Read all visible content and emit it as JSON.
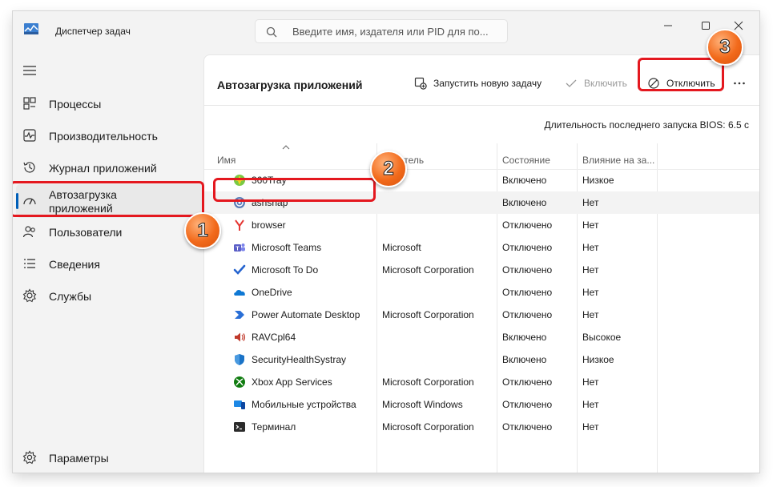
{
  "titlebar": {
    "title": "Диспетчер задач",
    "search_placeholder": "Введите имя, издателя или PID для по..."
  },
  "sidebar": {
    "items": [
      {
        "label": "Процессы",
        "icon": "processes-icon"
      },
      {
        "label": "Производительность",
        "icon": "performance-icon"
      },
      {
        "label": "Журнал приложений",
        "icon": "app-history-icon"
      },
      {
        "label": "Автозагрузка приложений",
        "icon": "startup-apps-icon",
        "active": true
      },
      {
        "label": "Пользователи",
        "icon": "users-icon"
      },
      {
        "label": "Сведения",
        "icon": "details-icon"
      },
      {
        "label": "Службы",
        "icon": "services-icon"
      }
    ],
    "settings_label": "Параметры"
  },
  "main": {
    "title": "Автозагрузка приложений",
    "toolbar": {
      "run_task": "Запустить новую задачу",
      "enable": "Включить",
      "disable": "Отключить"
    },
    "bios_text": "Длительность последнего запуска BIOS: 6.5 с",
    "columns": [
      "Имя",
      "Издатель",
      "Состояние",
      "Влияние на за..."
    ],
    "rows": [
      {
        "name": "360Tray",
        "publisher": "",
        "status": "Включено",
        "impact": "Низкое",
        "icon": "360tray-icon"
      },
      {
        "name": "ashsnap",
        "publisher": "",
        "status": "Включено",
        "impact": "Нет",
        "icon": "ashsnap-icon",
        "selected": true
      },
      {
        "name": "browser",
        "publisher": "",
        "status": "Отключено",
        "impact": "Нет",
        "icon": "yandex-browser-icon"
      },
      {
        "name": "Microsoft Teams",
        "publisher": "Microsoft",
        "status": "Отключено",
        "impact": "Нет",
        "icon": "teams-icon"
      },
      {
        "name": "Microsoft To Do",
        "publisher": "Microsoft Corporation",
        "status": "Отключено",
        "impact": "Нет",
        "icon": "todo-icon"
      },
      {
        "name": "OneDrive",
        "publisher": "",
        "status": "Отключено",
        "impact": "Нет",
        "icon": "onedrive-icon"
      },
      {
        "name": "Power Automate Desktop",
        "publisher": "Microsoft Corporation",
        "status": "Отключено",
        "impact": "Нет",
        "icon": "power-automate-icon"
      },
      {
        "name": "RAVCpl64",
        "publisher": "",
        "status": "Включено",
        "impact": "Высокое",
        "icon": "speaker-icon"
      },
      {
        "name": "SecurityHealthSystray",
        "publisher": "",
        "status": "Включено",
        "impact": "Низкое",
        "icon": "security-shield-icon"
      },
      {
        "name": "Xbox App Services",
        "publisher": "Microsoft Corporation",
        "status": "Отключено",
        "impact": "Нет",
        "icon": "xbox-icon"
      },
      {
        "name": "Мобильные устройства",
        "publisher": "Microsoft Windows",
        "status": "Отключено",
        "impact": "Нет",
        "icon": "phone-link-icon"
      },
      {
        "name": "Терминал",
        "publisher": "Microsoft Corporation",
        "status": "Отключено",
        "impact": "Нет",
        "icon": "terminal-icon"
      }
    ]
  },
  "annotations": {
    "badge1": "1",
    "badge2": "2",
    "badge3": "3",
    "highlight_color": "#e4181f",
    "badge_color": "#f26a1b"
  },
  "colors": {
    "accent": "#005fb8",
    "window_bg": "#f3f3f3",
    "panel_bg": "#ffffff"
  }
}
